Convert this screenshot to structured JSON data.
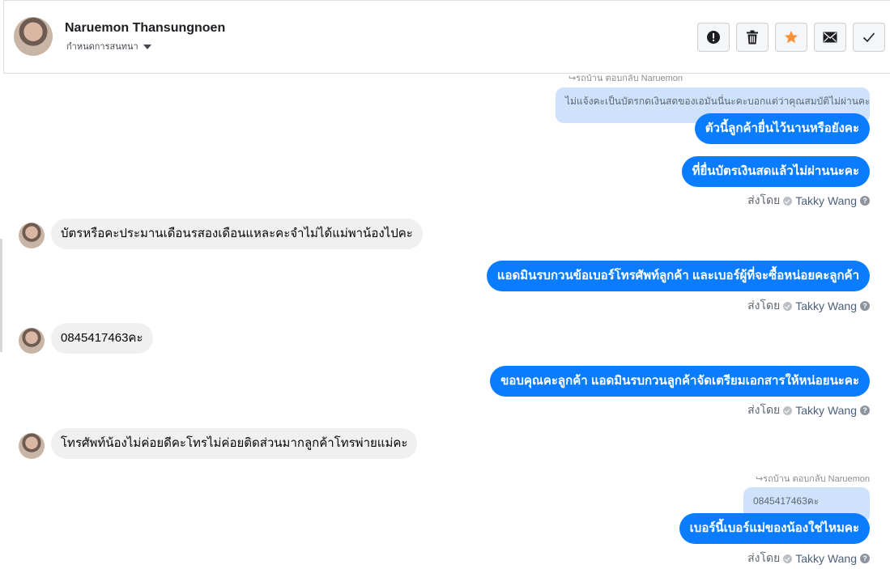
{
  "header": {
    "contact_name": "Naruemon Thansungnoen",
    "assign_label": "กำหนดการสนทนา",
    "actions": [
      {
        "icon": "alert-icon",
        "name": "mark-spam-button"
      },
      {
        "icon": "trash-icon",
        "name": "delete-button"
      },
      {
        "icon": "star-icon",
        "name": "star-button"
      },
      {
        "icon": "mail-icon",
        "name": "mark-unread-button"
      },
      {
        "icon": "check-icon",
        "name": "mark-done-button"
      }
    ]
  },
  "messages": {
    "reply1_line": "รถบ้าน ตอบกลับ Naruemon",
    "reply1_quote": "ไม่แจ้งคะเป็นบัตรกดเงินสดของเอมันนี่นะคะบอกแต่ว่าคุณสมบัติไม่ผ่านคะ",
    "out1": "ตัวนี้ลูกค้ายื่นไว้นานหรือยังคะ",
    "out2": "ที่ยื่นบัตรเงินสดแล้วไม่ผ่านนะคะ",
    "sent_by_label": "ส่งโดย",
    "agent_name": "Takky Wang",
    "in1": "บัตรหรือคะประมานเดือนรสองเดือนแหละคะจำไม่ได้แม่พาน้องไปคะ",
    "out3": "แอดมินรบกวนข้อเบอร์โทรศัพท์ลูกค้า และเบอร์ผู้ที่จะซื้อหน่อยคะลูกค้า",
    "in2": "0845417463คะ",
    "out4": "ขอบคุณคะลูกค้า แอดมินรบกวนลูกค้าจัดเตรียมเอกสารให้หน่อยนะคะ",
    "in3": "โทรศัพท์น้องไม่ค่อยดีคะโทรไม่ค่อยติดส่วนมากลูกค้าโทรพ่ายแม่คะ",
    "reply2_line": "รถบ้าน ตอบกลับ Naruemon",
    "reply2_quote": "0845417463คะ",
    "out5": "เบอร์นี้เบอร์แม่ของน้องใช่ไหมคะ"
  },
  "colors": {
    "outgoing_bubble": "#0a7cff",
    "incoming_bubble": "#f0f0f0",
    "quote_bubble": "#cfe2fb",
    "star": "#f7923b"
  }
}
